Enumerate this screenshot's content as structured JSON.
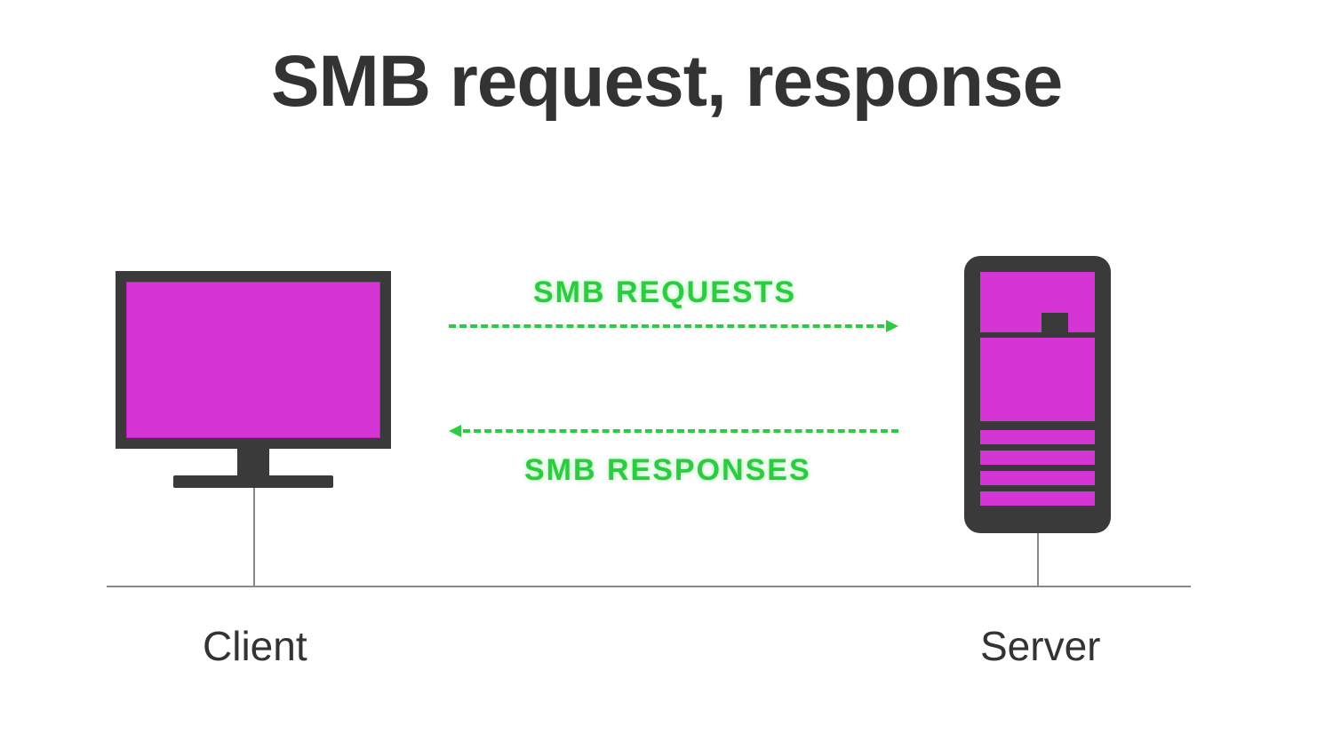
{
  "title": "SMB request, response",
  "nodes": {
    "client": {
      "label": "Client"
    },
    "server": {
      "label": "Server"
    }
  },
  "arrows": {
    "request": {
      "label": "SMB REQUESTS",
      "direction": "client-to-server"
    },
    "response": {
      "label": "SMB RESPONSES",
      "direction": "server-to-client"
    }
  },
  "colors": {
    "accent_green": "#2bcc3f",
    "magenta": "#d635d6",
    "dark": "#3a3a3a",
    "line": "#888888"
  }
}
